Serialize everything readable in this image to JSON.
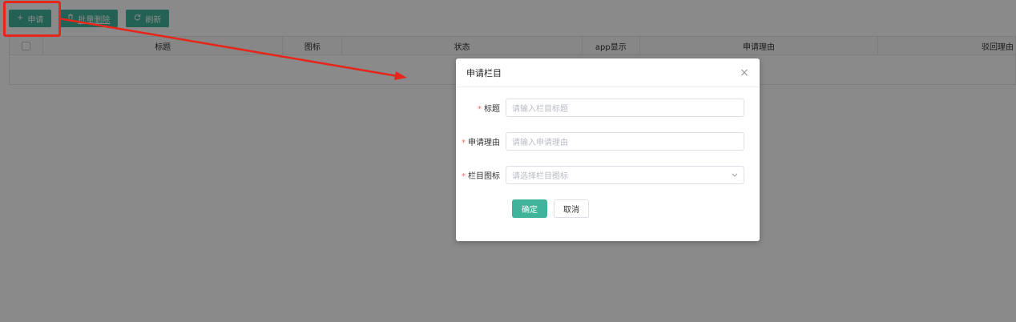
{
  "toolbar": {
    "apply_label": "申请",
    "apply_icon": "plus-icon",
    "batch_delete_label": "批量删除",
    "batch_delete_icon": "trash-icon",
    "refresh_label": "刷新",
    "refresh_icon": "refresh-icon",
    "button_color": "#3fb49a"
  },
  "table": {
    "columns": [
      "标题",
      "图标",
      "状态",
      "app显示",
      "申请理由",
      "驳回理由"
    ]
  },
  "modal": {
    "title": "申请栏目",
    "fields": [
      {
        "label": "标题",
        "placeholder": "请输入栏目标题",
        "required": true
      },
      {
        "label": "申请理由",
        "placeholder": "请输入申请理由",
        "required": true
      },
      {
        "label": "栏目图标",
        "placeholder": "请选择栏目图标",
        "required": true
      }
    ],
    "confirm_label": "确定",
    "cancel_label": "取消"
  },
  "annotation": {
    "highlight_color": "#e6261b"
  }
}
